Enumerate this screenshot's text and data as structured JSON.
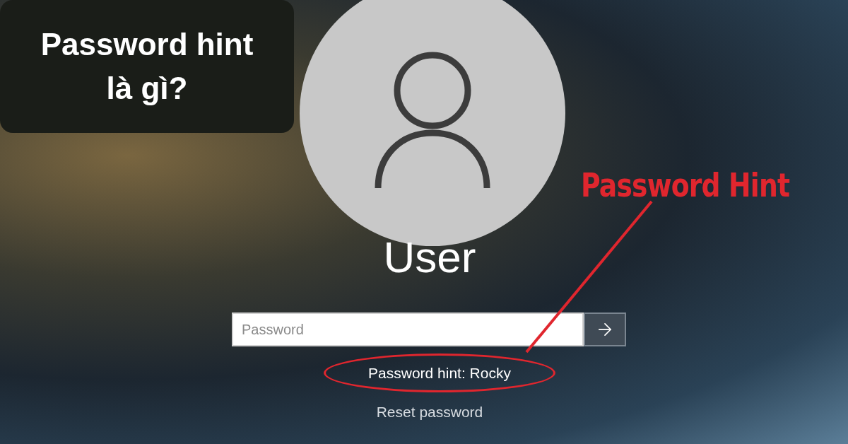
{
  "title_card": {
    "lines": [
      "Password hint",
      "là gì?"
    ]
  },
  "user": {
    "name": "User"
  },
  "password_field": {
    "placeholder": "Password"
  },
  "hint": {
    "text": "Password hint: Rocky"
  },
  "reset_link": {
    "label": "Reset password"
  },
  "annotation": {
    "label": "Password Hint"
  }
}
